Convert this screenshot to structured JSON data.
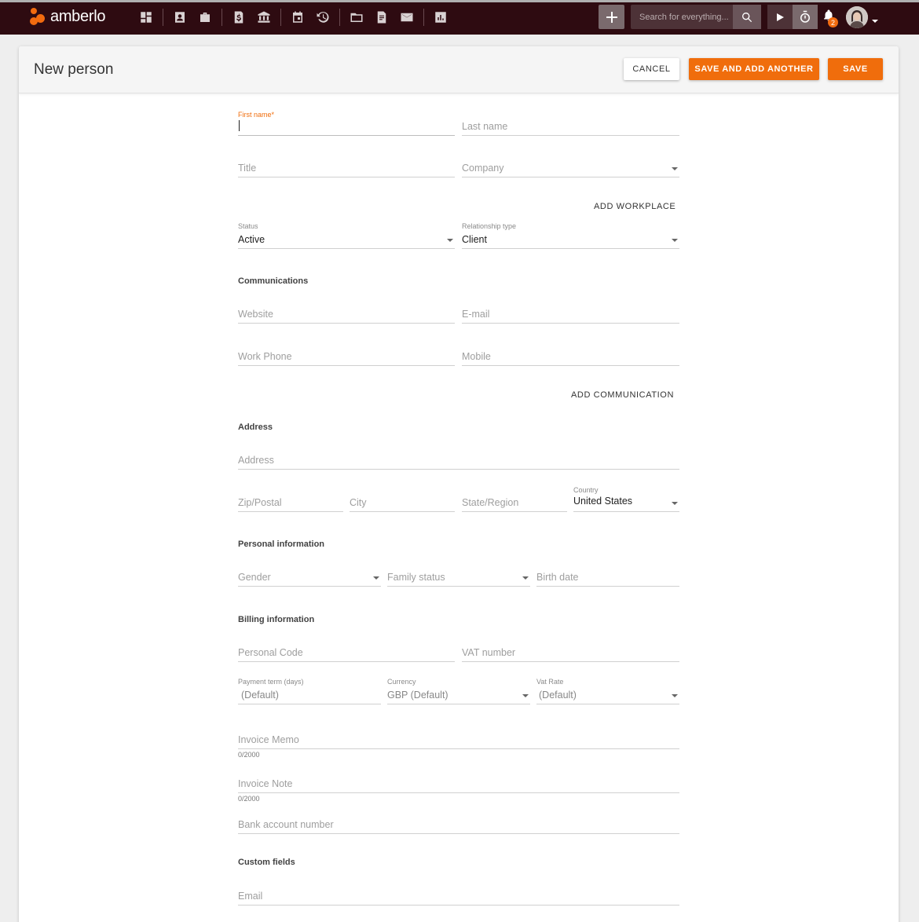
{
  "app": {
    "name": "amberlo"
  },
  "topbar": {
    "nav_icons": [
      "dashboard-icon",
      "contacts-icon",
      "briefcase-icon",
      "invoice-icon",
      "bank-icon",
      "calendar-icon",
      "time-history-icon",
      "folder-icon",
      "document-icon",
      "mail-icon",
      "reports-icon"
    ],
    "search_placeholder": "Search for everything...",
    "notification_count": "2"
  },
  "page": {
    "title": "New person"
  },
  "actions": {
    "cancel": "CANCEL",
    "save_and_add_another": "SAVE AND ADD ANOTHER",
    "save": "SAVE"
  },
  "form": {
    "first_name_label": "First name*",
    "last_name": "Last name",
    "title": "Title",
    "company": "Company",
    "add_workplace": "ADD WORKPLACE",
    "status_label": "Status",
    "status_value": "Active",
    "relationship_label": "Relationship type",
    "relationship_value": "Client",
    "communications_title": "Communications",
    "website": "Website",
    "email": "E-mail",
    "work_phone": "Work Phone",
    "mobile": "Mobile",
    "add_communication": "ADD COMMUNICATION",
    "address_title": "Address",
    "address": "Address",
    "zip": "Zip/Postal",
    "city": "City",
    "state": "State/Region",
    "country_label": "Country",
    "country_value": "United States",
    "personal_title": "Personal information",
    "gender": "Gender",
    "family_status": "Family status",
    "birth_date": "Birth date",
    "billing_title": "Billing information",
    "personal_code": "Personal Code",
    "vat_number": "VAT number",
    "payment_term_label": "Payment term (days)",
    "payment_term_value": "(Default)",
    "currency_label": "Currency",
    "currency_value": "GBP (Default)",
    "vat_rate_label": "Vat Rate",
    "vat_rate_value": "(Default)",
    "invoice_memo": "Invoice Memo",
    "invoice_memo_counter": "0/2000",
    "invoice_note": "Invoice Note",
    "invoice_note_counter": "0/2000",
    "bank_account": "Bank account number",
    "custom_title": "Custom fields",
    "custom_email": "Email"
  }
}
